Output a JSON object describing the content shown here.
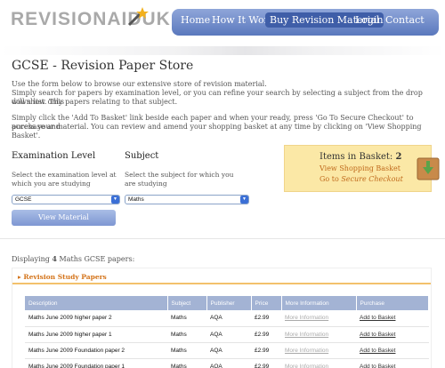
{
  "header": {
    "logo_text": "REVISIONAIDUK",
    "nav": [
      "Home",
      "How It Works",
      "Buy Revision Material",
      "Login",
      "Contact"
    ],
    "active_nav": "Buy Revision Material"
  },
  "page": {
    "title": "GCSE - Revision Paper Store",
    "intro_1": "Use the form below to browse our extensive store of revision material.",
    "intro_2": "Simply search for papers by examination level, or you can refine your search by selecting a subject from the drop down list. This",
    "intro_3": "will show only papers relating to that subject.",
    "intro_4": "Simply click the 'Add To Basket' link beside each paper and when your ready, press 'Go To Secure Checkout' to purchase and",
    "intro_5": "access your material. You can review and amend your shopping basket at any time by clicking on 'View Shopping Basket'."
  },
  "filters": {
    "exam_label": "Examination Level",
    "exam_desc": "Select the examination level at which you are studying",
    "exam_value": "GCSE",
    "subject_label": "Subject",
    "subject_desc": "Select the subject for which you are studying",
    "subject_value": "Maths",
    "view_button": "View Material"
  },
  "basket": {
    "title": "Items in Basket:",
    "count": "2",
    "view_link": "View Shopping Basket",
    "checkout_prefix": "Go to ",
    "checkout_link": "Secure Checkout"
  },
  "results": {
    "displaying_prefix": "Displaying ",
    "count": "4",
    "displaying_suffix": " Maths GCSE papers:",
    "panel_title": "Revision Study Papers",
    "columns": [
      "Description",
      "Subject",
      "Publisher",
      "Price",
      "More Information",
      "Purchase"
    ],
    "rows": [
      {
        "description": "Maths June 2009 higher paper 2",
        "subject": "Maths",
        "publisher": "AQA",
        "price": "£2.99",
        "more": "More Information",
        "purchase": "Add to Basket"
      },
      {
        "description": "Maths June 2009 higher paper 1",
        "subject": "Maths",
        "publisher": "AQA",
        "price": "£2.99",
        "more": "More Information",
        "purchase": "Add to Basket"
      },
      {
        "description": "Maths June 2009 Foundation paper 2",
        "subject": "Maths",
        "publisher": "AQA",
        "price": "£2.99",
        "more": "More Information",
        "purchase": "Add to Basket"
      },
      {
        "description": "Maths June 2009 Foundation paper 1",
        "subject": "Maths",
        "publisher": "AQA",
        "price": "£2.99",
        "more": "More Information",
        "purchase": "Add to Basket"
      }
    ]
  },
  "colors": {
    "nav_blue": "#5a78bd",
    "basket_bg": "#fbe8a6",
    "link_orange": "#c06a1c",
    "table_header": "#a3b3d4"
  }
}
